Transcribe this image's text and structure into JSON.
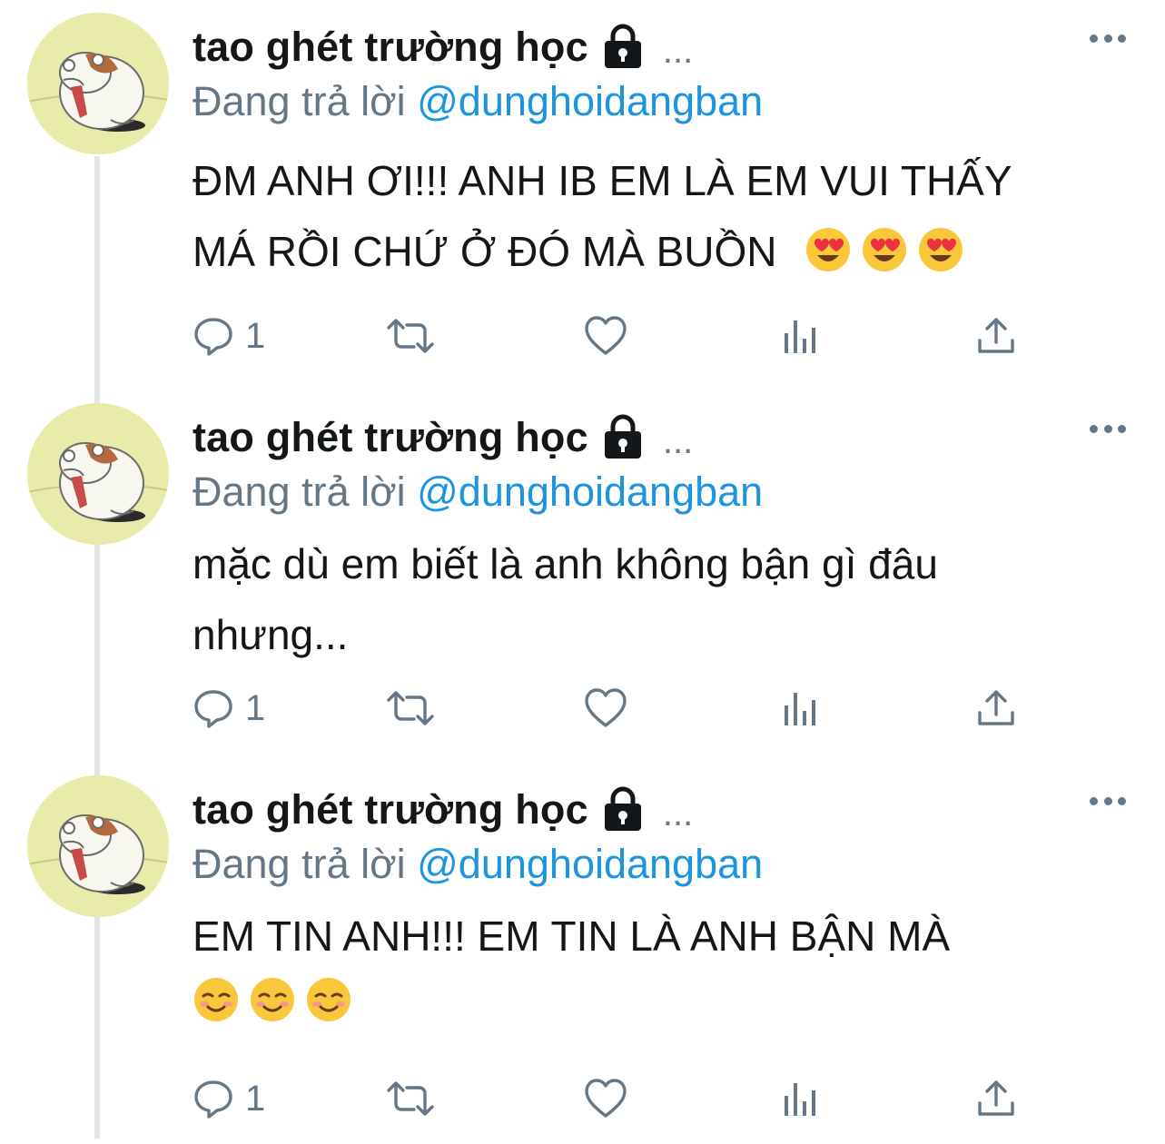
{
  "colors": {
    "accent": "#1b95e0",
    "muted": "#657786",
    "text": "#14171a",
    "line": "#e1e6ea",
    "avatar_bg": "#e9ebaa"
  },
  "icons": {
    "reply": "reply-bubble-icon",
    "retweet": "retweet-icon",
    "like": "heart-icon",
    "analytics": "analytics-bars-icon",
    "share": "share-upload-icon",
    "lock": "lock-icon",
    "more": "more-horizontal-icon"
  },
  "tweets": [
    {
      "author_name": "tao ghét trường học",
      "ellipsis": "...",
      "reply_prefix": "Đang trả lời",
      "reply_handle": "@dunghoidangban",
      "line1": "ĐM ANH ƠI!!! ANH IB EM LÀ EM VUI THẤY",
      "line2": "MÁ RỒI CHỨ Ở ĐÓ MÀ BUỒN",
      "emoji": "heart-eyes-face",
      "reply_count": "1"
    },
    {
      "author_name": "tao ghét trường học",
      "ellipsis": "...",
      "reply_prefix": "Đang trả lời",
      "reply_handle": "@dunghoidangban",
      "line1": "mặc dù em biết là anh không bận gì đâu",
      "line2": "nhưng...",
      "reply_count": "1"
    },
    {
      "author_name": "tao ghét trường học",
      "ellipsis": "...",
      "reply_prefix": "Đang trả lời",
      "reply_handle": "@dunghoidangban",
      "line1": "EM TIN ANH!!! EM TIN LÀ ANH BẬN MÀ",
      "emoji": "smiling-face",
      "reply_count": "1"
    }
  ]
}
